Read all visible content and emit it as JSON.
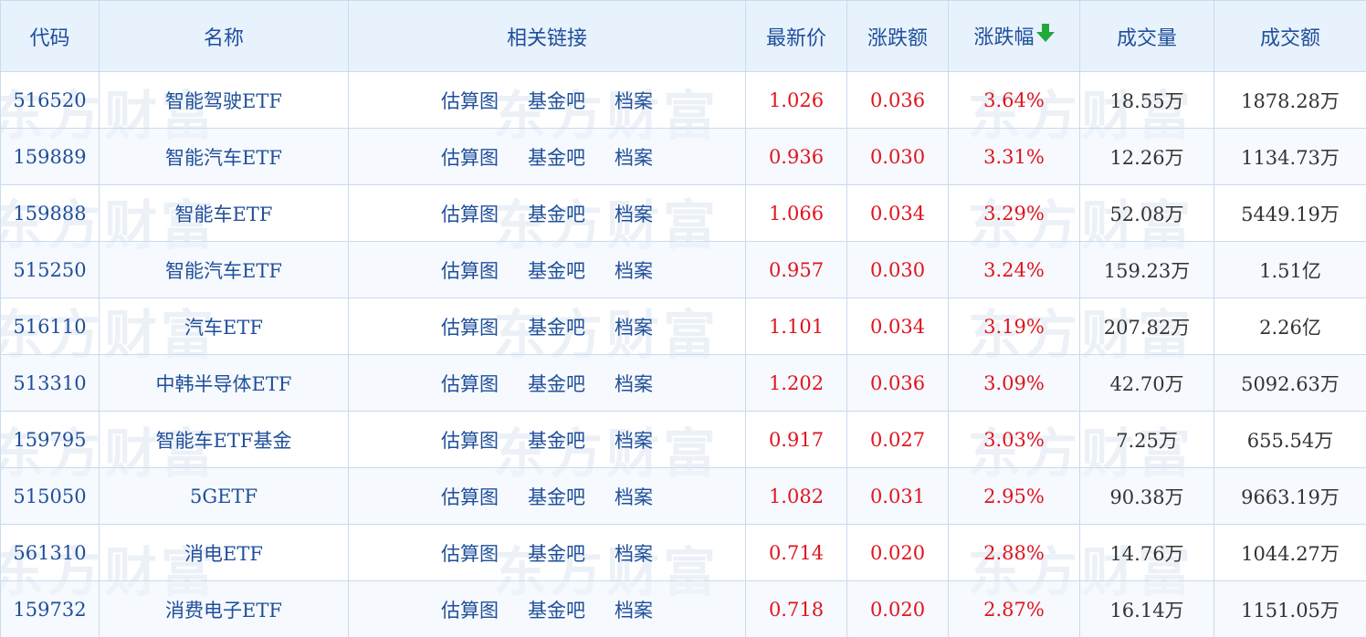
{
  "watermark_text": "东方财富",
  "headers": {
    "code": "代码",
    "name": "名称",
    "links": "相关链接",
    "price": "最新价",
    "change": "涨跌额",
    "pct": "涨跌幅",
    "volume": "成交量",
    "amount": "成交额"
  },
  "sort": {
    "column": "pct",
    "direction": "desc",
    "icon": "arrow-down-icon",
    "color": "#22a83c"
  },
  "links": [
    "估算图",
    "基金吧",
    "档案"
  ],
  "colors": {
    "header_bg": "#e8f2fd",
    "header_text": "#1f4f9a",
    "up": "#e0141e",
    "border": "#c8dbef"
  },
  "rows": [
    {
      "code": "516520",
      "name": "智能驾驶ETF",
      "price": "1.026",
      "change": "0.036",
      "pct": "3.64%",
      "volume": "18.55万",
      "amount": "1878.28万"
    },
    {
      "code": "159889",
      "name": "智能汽车ETF",
      "price": "0.936",
      "change": "0.030",
      "pct": "3.31%",
      "volume": "12.26万",
      "amount": "1134.73万"
    },
    {
      "code": "159888",
      "name": "智能车ETF",
      "price": "1.066",
      "change": "0.034",
      "pct": "3.29%",
      "volume": "52.08万",
      "amount": "5449.19万"
    },
    {
      "code": "515250",
      "name": "智能汽车ETF",
      "price": "0.957",
      "change": "0.030",
      "pct": "3.24%",
      "volume": "159.23万",
      "amount": "1.51亿"
    },
    {
      "code": "516110",
      "name": "汽车ETF",
      "price": "1.101",
      "change": "0.034",
      "pct": "3.19%",
      "volume": "207.82万",
      "amount": "2.26亿"
    },
    {
      "code": "513310",
      "name": "中韩半导体ETF",
      "price": "1.202",
      "change": "0.036",
      "pct": "3.09%",
      "volume": "42.70万",
      "amount": "5092.63万"
    },
    {
      "code": "159795",
      "name": "智能车ETF基金",
      "price": "0.917",
      "change": "0.027",
      "pct": "3.03%",
      "volume": "7.25万",
      "amount": "655.54万"
    },
    {
      "code": "515050",
      "name": "5GETF",
      "price": "1.082",
      "change": "0.031",
      "pct": "2.95%",
      "volume": "90.38万",
      "amount": "9663.19万"
    },
    {
      "code": "561310",
      "name": "消电ETF",
      "price": "0.714",
      "change": "0.020",
      "pct": "2.88%",
      "volume": "14.76万",
      "amount": "1044.27万"
    },
    {
      "code": "159732",
      "name": "消费电子ETF",
      "price": "0.718",
      "change": "0.020",
      "pct": "2.87%",
      "volume": "16.14万",
      "amount": "1151.05万"
    }
  ]
}
